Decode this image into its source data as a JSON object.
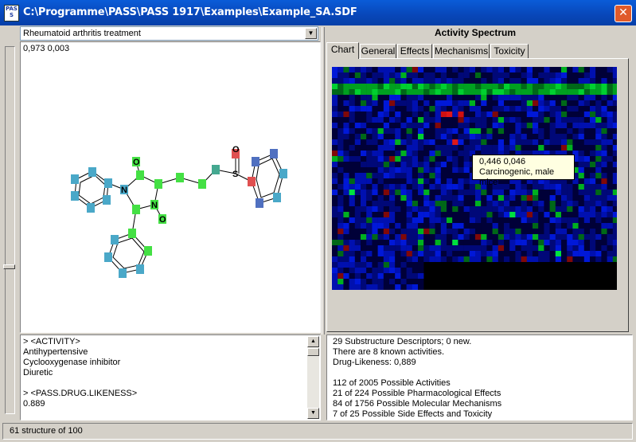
{
  "window": {
    "app_icon_text": "PAS S",
    "title": "C:\\Programme\\PASS\\PASS 1917\\Examples\\Example_SA.SDF",
    "close_label": "✕"
  },
  "combo": {
    "selected": "Rheumatoid arthritis treatment",
    "arrow": "▼"
  },
  "prediction": "0,973  0,003",
  "molecule_atoms": {
    "o1": "O",
    "o2": "O",
    "n1": "N",
    "n2": "N",
    "s": "S",
    "o3": "O",
    "o4": "O"
  },
  "spectrum": {
    "title": "Activity Spectrum",
    "tabs": [
      {
        "label": "Chart"
      },
      {
        "label": "General"
      },
      {
        "label": "Effects"
      },
      {
        "label": "Mechanisms"
      },
      {
        "label": "Toxicity"
      }
    ],
    "tooltip": {
      "line1": "0,446  0,046",
      "line2": "Carcinogenic, male mice"
    },
    "heatmap_colors": {
      "background": "#000060",
      "blue": "#0010c0",
      "green": "#00b020",
      "red": "#c01010"
    }
  },
  "properties": {
    "lines": [
      ">  <ACTIVITY>",
      "Antihypertensive",
      "Cyclooxygenase inhibitor",
      "Diuretic",
      "",
      ">  <PASS.DRUG.LIKENESS>",
      "0.889"
    ]
  },
  "info": {
    "lines": [
      "29  Substructure Descriptors;  0  new.",
      "There are 8 known activities.",
      "Drug-Likeness:   0,889",
      "",
      "112 of 2005 Possible Activities",
      "21 of 224 Possible Pharmacological Effects",
      "84 of 1756 Possible Molecular Mechanisms",
      "7 of 25 Possible Side Effects and Toxicity"
    ]
  },
  "status": "61 structure of 100"
}
